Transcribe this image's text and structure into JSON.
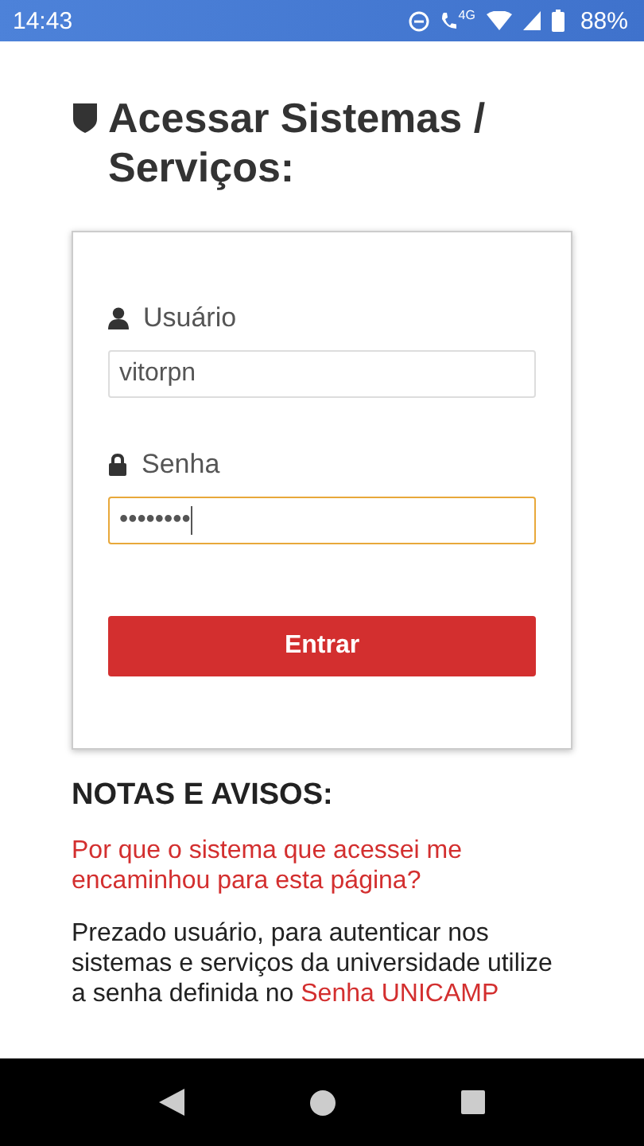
{
  "status_bar": {
    "time": "14:43",
    "network": "4G",
    "battery": "88%"
  },
  "title": "Acessar Sistemas / Serviços:",
  "login": {
    "fields": [
      {
        "kind": "user",
        "label": "Usuário",
        "value": "vitorpn",
        "focused": false
      },
      {
        "kind": "password",
        "label": "Senha",
        "value": "••••••••",
        "focused": true
      }
    ],
    "button": "Entrar"
  },
  "notes": {
    "heading": "NOTAS E AVISOS:",
    "question": "Por que o sistema que acessei me encaminhou para esta página?",
    "paragraph": "Prezado usuário, para autenticar nos sistemas e serviços da universidade utilize a senha definida no",
    "link": "Senha UNICAMP"
  }
}
